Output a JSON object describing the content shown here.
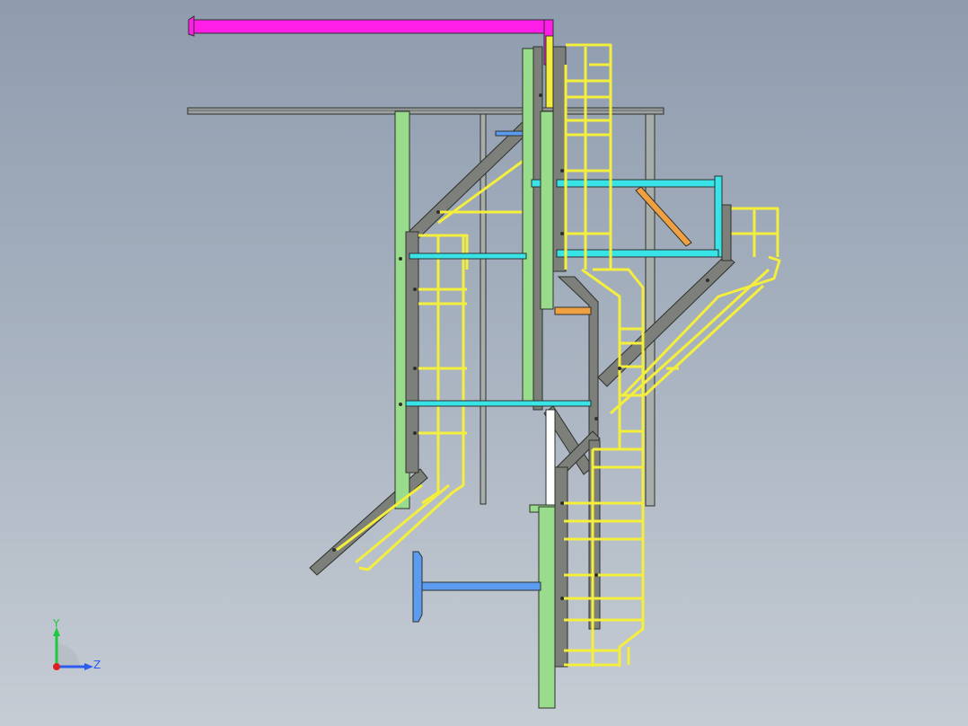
{
  "viewport": {
    "background_top": "#8e9cae",
    "background_bottom": "#c6ccd4"
  },
  "colors": {
    "steel": "#7d7f7a",
    "steel_edge": "#2e302c",
    "column": "#98dc8c",
    "handrail": "#f4ee3c",
    "cyan_beam": "#38e4e8",
    "magenta_beam": "#ff1ee8",
    "blue_part": "#5c9cf0",
    "orange_part": "#f0a040",
    "white_part": "#ffffff"
  },
  "triad": {
    "y_label": "Y",
    "z_label": "Z",
    "y_color": "#1fc83c",
    "z_color": "#2a5cf0",
    "x_color": "#e02020"
  }
}
